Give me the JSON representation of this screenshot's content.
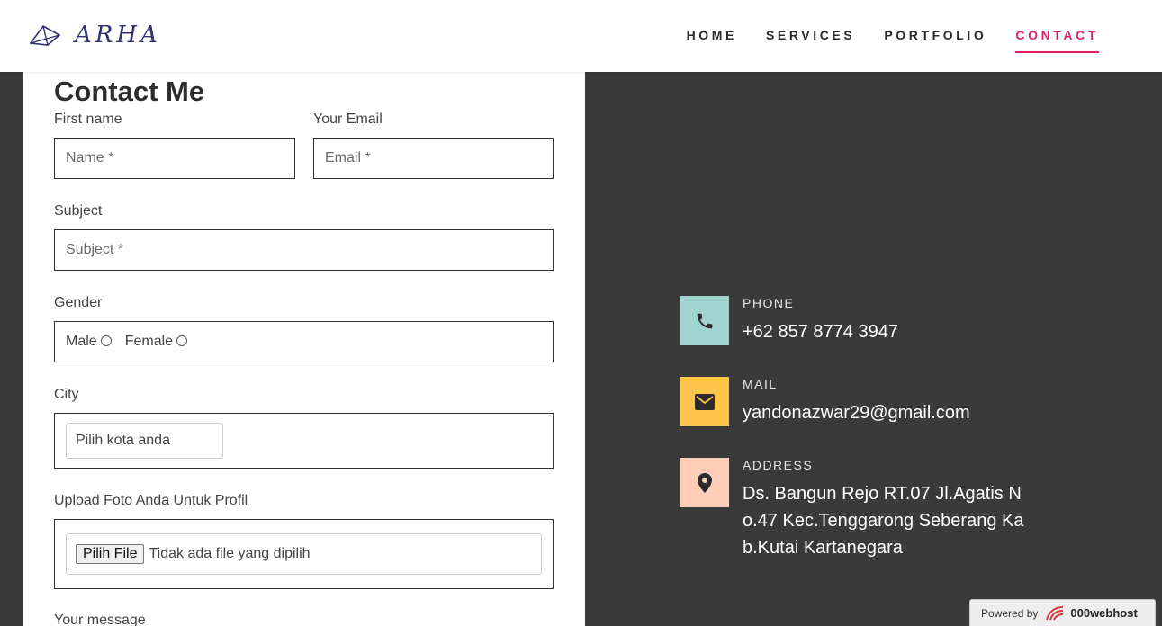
{
  "header": {
    "logo_text": "ARHA",
    "nav": [
      {
        "label": "HOME"
      },
      {
        "label": "SERVICES"
      },
      {
        "label": "PORTFOLIO"
      },
      {
        "label": "CONTACT"
      }
    ],
    "active_nav": "CONTACT",
    "accent_color": "#e0245e"
  },
  "form": {
    "title": "Contact Me",
    "first_name_label": "First name",
    "first_name_placeholder": "Name *",
    "email_label": "Your Email",
    "email_placeholder": "Email *",
    "subject_label": "Subject",
    "subject_placeholder": "Subject *",
    "gender_label": "Gender",
    "gender_options": [
      "Male",
      "Female"
    ],
    "city_label": "City",
    "city_select_value": "Pilih kota anda",
    "upload_label": "Upload Foto Anda Untuk Profil",
    "upload_button": "Pilih File",
    "upload_status": "Tidak ada file yang dipilih",
    "message_label": "Your message"
  },
  "contact_info": [
    {
      "heading": "PHONE",
      "value": "+62 857 8774 3947",
      "icon": "phone-icon",
      "color": "#9fd4d0"
    },
    {
      "heading": "MAIL",
      "value": "yandonazwar29@gmail.com",
      "icon": "mail-icon",
      "color": "#ffc44a"
    },
    {
      "heading": "ADDRESS",
      "value_lines": [
        "Ds. Bangun Rejo RT.07 Jl.Agatis N",
        "o.47 Kec.Tenggarong Seberang Ka",
        "b.Kutai Kartanegara"
      ],
      "icon": "location-pin-icon",
      "color": "#ffcdb8"
    }
  ],
  "footer_badge": {
    "prefix": "Powered by",
    "brand": "000webhost"
  }
}
